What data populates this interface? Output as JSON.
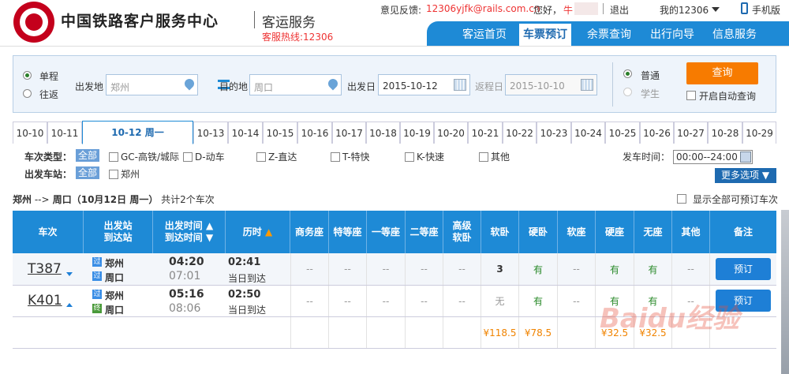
{
  "header": {
    "site_title": "中国铁路客户服务中心",
    "service_title": "客运服务",
    "hotline": "客服热线:12306",
    "feedback_label": "意见反馈:",
    "feedback_email": "12306yjfk@rails.com.cn",
    "greeting": "您好，",
    "user_name": "牛",
    "logout": "退出",
    "my12306": "我的12306",
    "mobile": "手机版"
  },
  "nav": {
    "items": [
      "客运首页",
      "车票预订",
      "余票查询",
      "出行向导",
      "信息服务"
    ],
    "active": "车票预订"
  },
  "query": {
    "trip_oneway": "单程",
    "trip_round": "往返",
    "from_label": "出发地",
    "from_value": "郑州",
    "to_label": "目的地",
    "to_value": "周口",
    "depart_label": "出发日",
    "depart_value": "2015-10-12",
    "return_label": "返程日",
    "return_value": "2015-10-10",
    "type_normal": "普通",
    "type_student": "学生",
    "query_button": "查询",
    "auto_query": "开启自动查询"
  },
  "date_tabs": [
    "10-10",
    "10-11",
    "10-12 周一",
    "10-13",
    "10-14",
    "10-15",
    "10-16",
    "10-17",
    "10-18",
    "10-19",
    "10-20",
    "10-21",
    "10-22",
    "10-23",
    "10-24",
    "10-25",
    "10-26",
    "10-27",
    "10-28",
    "10-29"
  ],
  "active_date": "10-12 周一",
  "filters": {
    "train_type_label": "车次类型：",
    "all_label": "全部",
    "types": [
      "GC-高铁/城际",
      "D-动车",
      "Z-直达",
      "T-特快",
      "K-快速",
      "其他"
    ],
    "station_label": "出发车站：",
    "stations": [
      "郑州"
    ],
    "depart_time_label": "发车时间：",
    "depart_time_value": "00:00--24:00",
    "more_options": "更多选项"
  },
  "route_summary": {
    "from": "郑州",
    "arrow": " -->",
    "to": " 周口（",
    "date": "10月12日",
    "weekday": "  周一）",
    "count": "共计2个车次",
    "show_all": "显示全部可预订车次"
  },
  "table": {
    "headers": [
      "车次",
      "出发站到达站",
      "出发时间到达时间",
      "历时",
      "商务座",
      "特等座",
      "一等座",
      "二等座",
      "高级软卧",
      "软卧",
      "硬卧",
      "软座",
      "硬座",
      "无座",
      "其他",
      "备注"
    ],
    "header_lines": {
      "station_top": "出发站",
      "station_bottom": "到达站",
      "time_top": "出发时间",
      "time_bottom": "到达时间",
      "adv1": "高级",
      "adv2": "软卧"
    },
    "rows": [
      {
        "train": "T387",
        "from_badge": "过",
        "from": "郑州",
        "to_badge": "过",
        "to": "周口",
        "depart": "04:20",
        "arrive": "07:01",
        "duration": "02:41",
        "arrival_day": "当日到达",
        "seats": [
          "--",
          "--",
          "--",
          "--",
          "--",
          "3",
          "有",
          "--",
          "有",
          "有",
          "--"
        ],
        "book": "预订"
      },
      {
        "train": "K401",
        "from_badge": "过",
        "from": "郑州",
        "to_badge": "终",
        "to": "周口",
        "depart": "05:16",
        "arrive": "08:06",
        "duration": "02:50",
        "arrival_day": "当日到达",
        "seats": [
          "--",
          "--",
          "--",
          "--",
          "--",
          "无",
          "有",
          "--",
          "有",
          "有",
          "--"
        ],
        "book": "预订"
      }
    ],
    "prices": {
      "soft_sleeper": "¥118.5",
      "hard_sleeper": "¥78.5",
      "hard_seat": "¥32.5",
      "no_seat": "¥32.5"
    }
  },
  "watermark": "Baidu经验",
  "colors": {
    "brand_blue": "#1e8ad6",
    "brand_red": "#c4001c",
    "query_orange": "#f77b00",
    "available_green": "#2a8a2a",
    "price_orange": "#f08300"
  }
}
